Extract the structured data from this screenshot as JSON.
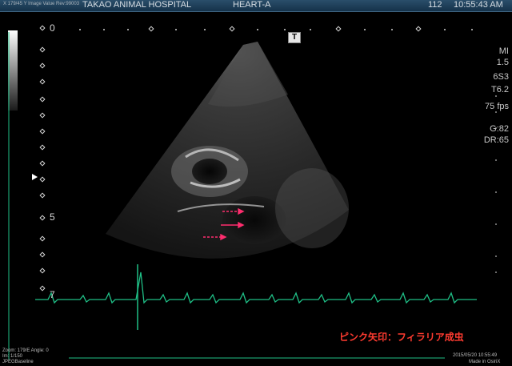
{
  "topbar": {
    "left_small": "X 179/45   Y Image Value Rev:99003",
    "hospital": "TAKAO ANIMAL HOSPITAL",
    "preset": "HEART-A",
    "frame_number": "112",
    "clock": "10:55:43 AM"
  },
  "depth_scale": {
    "top": "0",
    "mid": "5",
    "bottom": "7"
  },
  "parameters": [
    "MI",
    "1.5",
    "6S3",
    "T6.2",
    "75 fps",
    "G:82",
    "DR:65"
  ],
  "annotation": "ピンク矢印：フィラリア成虫",
  "footer": {
    "zoom": "Zoom: 179/E Angle: 0",
    "im": "Im: 1/150",
    "codec": "JPEGBaseline",
    "date": "2015/05/20 10:55:49",
    "made_in": "Made in OsiriX"
  },
  "colors": {
    "ecg": "#1fbf86",
    "arrow": "#ff2d6e",
    "note": "#ff3b30"
  },
  "icons": {
    "t_marker": "T",
    "focus_marker": "▶"
  }
}
